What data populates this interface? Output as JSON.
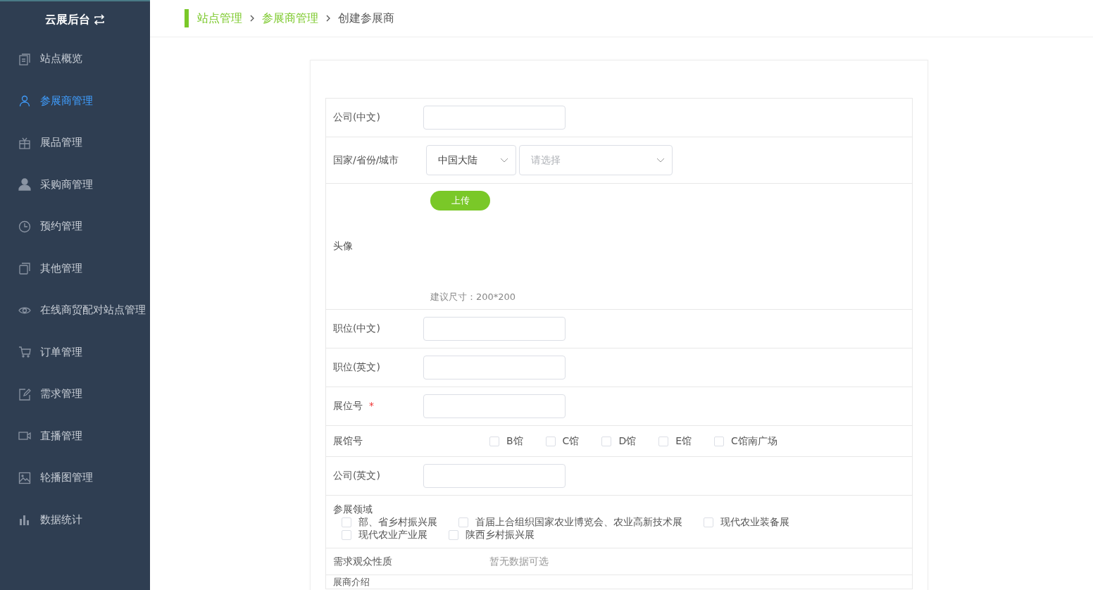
{
  "sidebar": {
    "title": "云展后台",
    "items": [
      {
        "label": "站点概览",
        "selected": false
      },
      {
        "label": "参展商管理",
        "selected": true
      },
      {
        "label": "展品管理",
        "selected": false
      },
      {
        "label": "采购商管理",
        "selected": false
      },
      {
        "label": "预约管理",
        "selected": false
      },
      {
        "label": "其他管理",
        "selected": false
      },
      {
        "label": "在线商贸配对站点管理",
        "selected": false
      },
      {
        "label": "订单管理",
        "selected": false
      },
      {
        "label": "需求管理",
        "selected": false
      },
      {
        "label": "直播管理",
        "selected": false
      },
      {
        "label": "轮播图管理",
        "selected": false
      },
      {
        "label": "数据统计",
        "selected": false
      }
    ]
  },
  "breadcrumb": [
    {
      "label": "站点管理",
      "link": true
    },
    {
      "label": "参展商管理",
      "link": true
    },
    {
      "label": "创建参展商",
      "link": false
    }
  ],
  "form": [
    {
      "kind": "text",
      "label": "公司(中文)"
    },
    {
      "kind": "selects",
      "label": "国家/省份/城市",
      "selects": [
        {
          "value": "中国大陆"
        },
        {
          "placeholder": "请选择"
        }
      ]
    },
    {
      "kind": "upload",
      "label": "头像",
      "button": "上传",
      "hint": "建议尺寸：200*200"
    },
    {
      "kind": "text",
      "label": "职位(中文)"
    },
    {
      "kind": "text",
      "label": "职位(英文)"
    },
    {
      "kind": "text",
      "label": "展位号",
      "required_mark": "*"
    },
    {
      "kind": "inline-checks",
      "label": "展馆号",
      "options": [
        {
          "label": "B馆",
          "checked": false
        },
        {
          "label": "C馆",
          "checked": false
        },
        {
          "label": "D馆",
          "checked": false
        },
        {
          "label": "E馆",
          "checked": false
        },
        {
          "label": "C馆南广场",
          "checked": false
        }
      ]
    },
    {
      "kind": "text",
      "label": "公司(英文)"
    },
    {
      "kind": "block-checks",
      "label": "参展领域",
      "options": [
        {
          "label": "部、省乡村振兴展",
          "checked": false
        },
        {
          "label": "首届上合组织国家农业博览会、农业高新技术展",
          "checked": false
        },
        {
          "label": "现代农业装备展",
          "checked": false
        },
        {
          "label": "现代农业产业展",
          "checked": false
        },
        {
          "label": "陕西乡村振兴展",
          "checked": false
        }
      ]
    },
    {
      "kind": "note",
      "label": "需求观众性质",
      "note": "暂无数据可选"
    },
    {
      "kind": "heading",
      "label": "展商介绍"
    }
  ]
}
